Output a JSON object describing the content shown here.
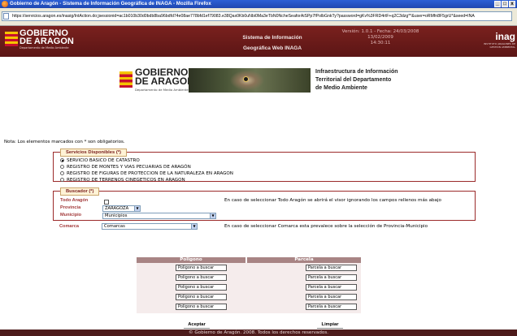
{
  "window": {
    "title": "Gobierno de Aragón - Sistema de Información Geográfica de INAGA - Mozilla Firefox",
    "minimize": "_",
    "maximize": "□",
    "close": "x"
  },
  "address_bar": {
    "url": "https://servicios.aragon.es/inasig/IntAction.do;jsessionid=ac1b010b30d0bdb8ba96bdfd74e08ae778bfd1ef79083.e38Qax0Kb0uNbi0Ma3eTbN0NcheSeaforAiSPp7fPolbGnkTy?password=gKv%3FRD4rtF+q2C3dzg**&user=oRMfn8F5grU*&seed=INA"
  },
  "header": {
    "logo_line1": "GOBIERNO",
    "logo_line2": "DE ARAGON",
    "logo_sub": "Departamento de Medio Ambiente",
    "system_title_line1": "Sistema de Información",
    "system_title_line2": "Geográfica Web INAGA",
    "version_line1": "Versión: 1.0.1 - Fecha: 24/03/2008",
    "version_line2": "13/02/2009",
    "version_line3": "14:30:11",
    "inaga_word": "inag",
    "inaga_sub": "INSTITUTO ARAGONÉS DE GESTIÓN AMBIENTAL"
  },
  "banner": {
    "logo_line1": "GOBIERNO",
    "logo_line2": "DE ARAGON",
    "logo_sub": "Departamento de Medio Ambiente",
    "heading_line1": "Infraestructura de Información",
    "heading_line2": "Territorial del Departamento",
    "heading_line3": "de Medio Ambiente"
  },
  "note": "Nota: Los elementos marcados con * son obligatorios.",
  "services": {
    "legend": "Servicios Disponibles (*)",
    "options": [
      {
        "label": "SERVICIO BASICO DE CATASTRO",
        "selected": true
      },
      {
        "label": "REGISTRO DE MONTES Y VIAS PECUARIAS DE ARAGÓN",
        "selected": false
      },
      {
        "label": "REGISTRO DE FIGURAS DE PROTECCION DE LA NATURALEZA EN ARAGON",
        "selected": false
      },
      {
        "label": "REGISTRO DE TERRENOS CINEGETICOS EN ARAGON",
        "selected": false
      }
    ]
  },
  "buscador": {
    "legend": "Buscador (*)",
    "todo_aragon_label": "Todo Aragón",
    "todo_aragon_help": "En caso de seleccionar Todo Aragón se abrirá el visor ignorando los campos rellenos más abajo",
    "provincia_label": "Provincia",
    "provincia_value": "ZARAGOZA",
    "municipio_label": "Municipio",
    "municipio_value": "Municipios",
    "comarca_label": "Comarca",
    "comarca_value": "Comarcas",
    "comarca_help": "En caso de seleccionar Comarca esta prevalece sobre la selección de Provincia-Municipio"
  },
  "table": {
    "poligono_header": "Poligono",
    "parcela_header": "Parcela",
    "poligono_placeholder": "Poligono a buscar",
    "parcela_placeholder": "Parcela a buscar"
  },
  "buttons": {
    "accept": "Aceptar",
    "clear": "Limpiar"
  },
  "footer": "© Gobierno de Aragón. 2008. Todos los derechos reservados."
}
